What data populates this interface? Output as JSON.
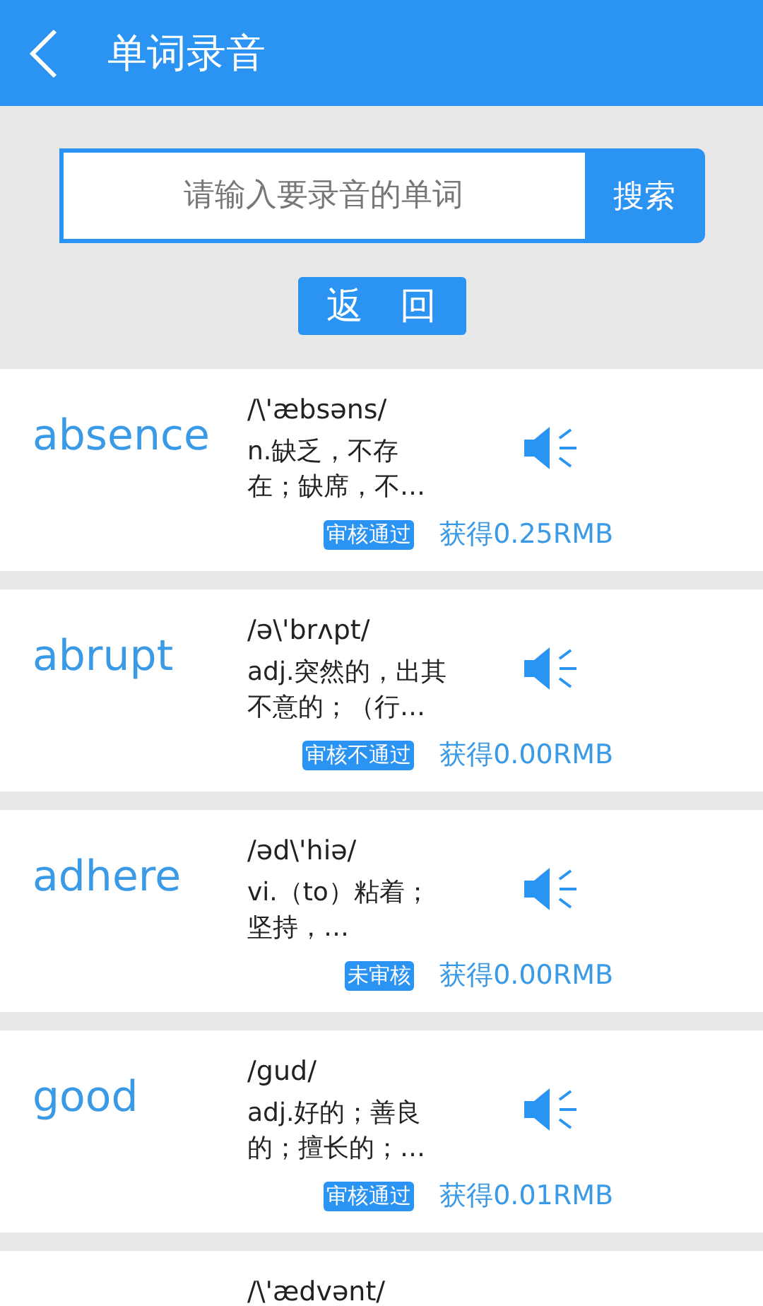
{
  "header": {
    "title": "单词录音"
  },
  "search": {
    "placeholder": "请输入要录音的单词",
    "button": "搜索"
  },
  "back_button": "返　回",
  "words": [
    {
      "word": "absence",
      "phonetic": "/\\'æbsəns/",
      "definition": "n.缺乏，不存在；缺席，不…",
      "status": "审核通过",
      "earnings": "获得0.25RMB"
    },
    {
      "word": "abrupt",
      "phonetic": "/ə\\'brʌpt/",
      "definition": "adj.突然的，出其不意的；（行…",
      "status": "审核不通过",
      "earnings": "获得0.00RMB"
    },
    {
      "word": "adhere",
      "phonetic": "/əd\\'hiə/",
      "definition": "vi.（to）粘着；坚持，…",
      "status": "未审核",
      "earnings": "获得0.00RMB"
    },
    {
      "word": "good",
      "phonetic": "/gud/",
      "definition": "adj.好的；善良的；擅长的；…",
      "status": "审核通过",
      "earnings": "获得0.01RMB"
    },
    {
      "phonetic": "/\\'ædvənt/"
    }
  ]
}
